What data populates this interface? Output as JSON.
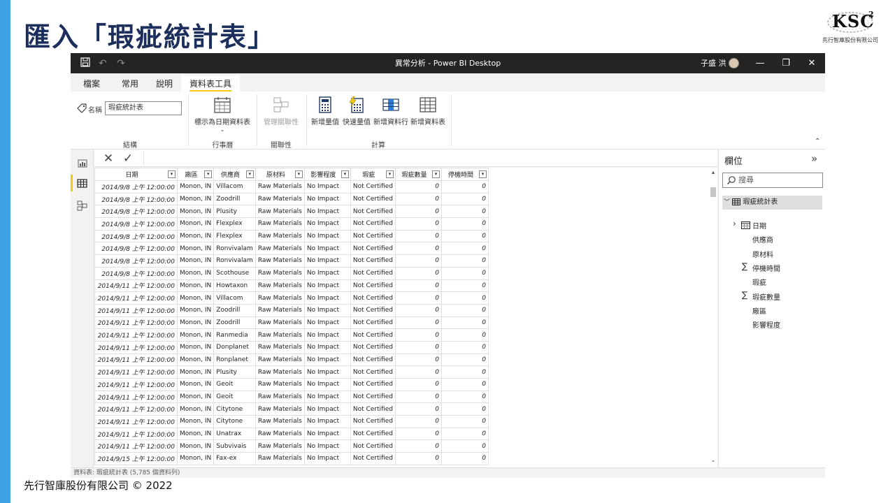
{
  "slide": {
    "title": "匯入「瑕疵統計表」",
    "footer": "先行智庫股份有限公司 © 2022",
    "logo_text": "KSC",
    "logo_sup": "2",
    "logo_sub": "先行智庫股份有限公司"
  },
  "window": {
    "title": "異常分析 - Power BI Desktop",
    "user": "子盛 洪"
  },
  "ribbon": {
    "tabs": [
      "檔案",
      "常用",
      "說明",
      "資料表工具"
    ],
    "active_tab": "資料表工具",
    "name_label": "名稱",
    "name_value": "瑕疵統計表",
    "mark_date_table": "標示為日期資料表",
    "manage_relationships": "管理關聯性",
    "new_measure": "新增量值",
    "quick_measure": "快速量值",
    "new_column": "新增資料行",
    "new_table": "新增資料表",
    "groups": {
      "structure": "結構",
      "calendar": "行事曆",
      "relationships": "關聯性",
      "calculations": "計算"
    },
    "accent_color": "#f2c811"
  },
  "grid": {
    "columns": [
      "日期",
      "廠區",
      "供應商",
      "原材料",
      "影響程度",
      "瑕疵",
      "瑕疵數量",
      "停機時間"
    ],
    "rows": [
      [
        "2014/9/8 上午 12:00:00",
        "Monon, IN",
        "Villacom",
        "Raw Materials",
        "No Impact",
        "Not Certified",
        "0",
        "0"
      ],
      [
        "2014/9/8 上午 12:00:00",
        "Monon, IN",
        "Zoodrill",
        "Raw Materials",
        "No Impact",
        "Not Certified",
        "0",
        "0"
      ],
      [
        "2014/9/8 上午 12:00:00",
        "Monon, IN",
        "Plusity",
        "Raw Materials",
        "No Impact",
        "Not Certified",
        "0",
        "0"
      ],
      [
        "2014/9/8 上午 12:00:00",
        "Monon, IN",
        "Flexplex",
        "Raw Materials",
        "No Impact",
        "Not Certified",
        "0",
        "0"
      ],
      [
        "2014/9/8 上午 12:00:00",
        "Monon, IN",
        "Flexplex",
        "Raw Materials",
        "No Impact",
        "Not Certified",
        "0",
        "0"
      ],
      [
        "2014/9/8 上午 12:00:00",
        "Monon, IN",
        "Ronvivalam",
        "Raw Materials",
        "No Impact",
        "Not Certified",
        "0",
        "0"
      ],
      [
        "2014/9/8 上午 12:00:00",
        "Monon, IN",
        "Ronvivalam",
        "Raw Materials",
        "No Impact",
        "Not Certified",
        "0",
        "0"
      ],
      [
        "2014/9/8 上午 12:00:00",
        "Monon, IN",
        "Scothouse",
        "Raw Materials",
        "No Impact",
        "Not Certified",
        "0",
        "0"
      ],
      [
        "2014/9/11 上午 12:00:00",
        "Monon, IN",
        "Howtaxon",
        "Raw Materials",
        "No Impact",
        "Not Certified",
        "0",
        "0"
      ],
      [
        "2014/9/11 上午 12:00:00",
        "Monon, IN",
        "Villacom",
        "Raw Materials",
        "No Impact",
        "Not Certified",
        "0",
        "0"
      ],
      [
        "2014/9/11 上午 12:00:00",
        "Monon, IN",
        "Zoodrill",
        "Raw Materials",
        "No Impact",
        "Not Certified",
        "0",
        "0"
      ],
      [
        "2014/9/11 上午 12:00:00",
        "Monon, IN",
        "Zoodrill",
        "Raw Materials",
        "No Impact",
        "Not Certified",
        "0",
        "0"
      ],
      [
        "2014/9/11 上午 12:00:00",
        "Monon, IN",
        "Ranmedia",
        "Raw Materials",
        "No Impact",
        "Not Certified",
        "0",
        "0"
      ],
      [
        "2014/9/11 上午 12:00:00",
        "Monon, IN",
        "Donplanet",
        "Raw Materials",
        "No Impact",
        "Not Certified",
        "0",
        "0"
      ],
      [
        "2014/9/11 上午 12:00:00",
        "Monon, IN",
        "Ronplanet",
        "Raw Materials",
        "No Impact",
        "Not Certified",
        "0",
        "0"
      ],
      [
        "2014/9/11 上午 12:00:00",
        "Monon, IN",
        "Plusity",
        "Raw Materials",
        "No Impact",
        "Not Certified",
        "0",
        "0"
      ],
      [
        "2014/9/11 上午 12:00:00",
        "Monon, IN",
        "Geoit",
        "Raw Materials",
        "No Impact",
        "Not Certified",
        "0",
        "0"
      ],
      [
        "2014/9/11 上午 12:00:00",
        "Monon, IN",
        "Geoit",
        "Raw Materials",
        "No Impact",
        "Not Certified",
        "0",
        "0"
      ],
      [
        "2014/9/11 上午 12:00:00",
        "Monon, IN",
        "Citytone",
        "Raw Materials",
        "No Impact",
        "Not Certified",
        "0",
        "0"
      ],
      [
        "2014/9/11 上午 12:00:00",
        "Monon, IN",
        "Citytone",
        "Raw Materials",
        "No Impact",
        "Not Certified",
        "0",
        "0"
      ],
      [
        "2014/9/11 上午 12:00:00",
        "Monon, IN",
        "Unatrax",
        "Raw Materials",
        "No Impact",
        "Not Certified",
        "0",
        "0"
      ],
      [
        "2014/9/11 上午 12:00:00",
        "Monon, IN",
        "Subvivais",
        "Raw Materials",
        "No Impact",
        "Not Certified",
        "0",
        "0"
      ],
      [
        "2014/9/15 上午 12:00:00",
        "Monon, IN",
        "Fax-ex",
        "Raw Materials",
        "No Impact",
        "Not Certified",
        "0",
        "0"
      ]
    ]
  },
  "status": {
    "text": "資料表: 瑕疵統計表 (5,785 個資料列)"
  },
  "fields": {
    "title": "欄位",
    "search_placeholder": "搜尋",
    "table_name": "瑕疵統計表",
    "items": [
      {
        "name": "日期",
        "kind": "date"
      },
      {
        "name": "供應商",
        "kind": "text"
      },
      {
        "name": "原材料",
        "kind": "text"
      },
      {
        "name": "停機時間",
        "kind": "sum"
      },
      {
        "name": "瑕疵",
        "kind": "text"
      },
      {
        "name": "瑕疵數量",
        "kind": "sum"
      },
      {
        "name": "廠區",
        "kind": "text"
      },
      {
        "name": "影響程度",
        "kind": "text"
      }
    ]
  }
}
